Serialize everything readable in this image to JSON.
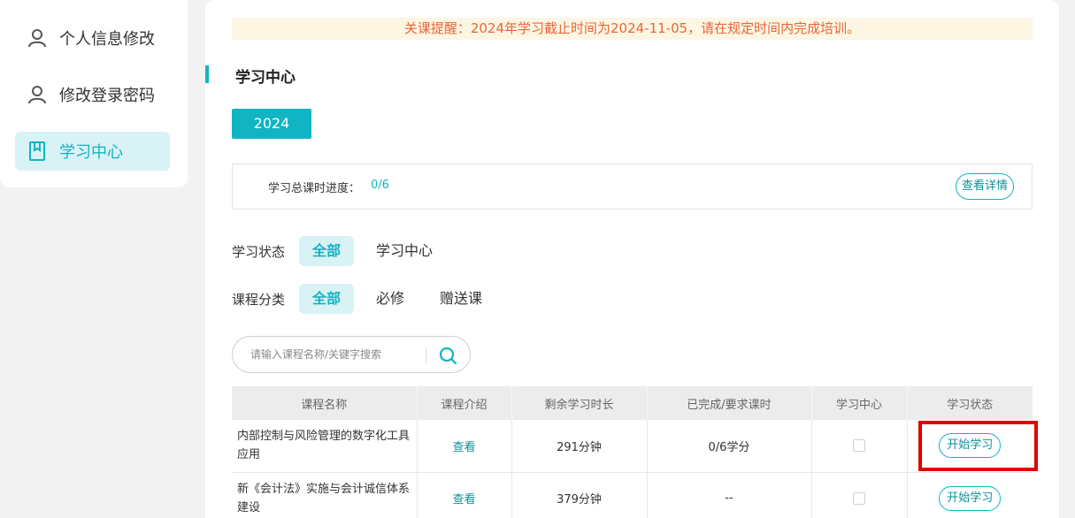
{
  "sidebar": {
    "items": [
      {
        "label": "个人信息修改",
        "icon": "user-icon"
      },
      {
        "label": "修改登录密码",
        "icon": "user-icon"
      },
      {
        "label": "学习中心",
        "icon": "bookmark-icon",
        "active": true
      }
    ]
  },
  "notice": "关课提醒：2024年学习截止时间为2024-11-05，请在规定时间内完成培训。",
  "section_title": "学习中心",
  "year_tab": "2024",
  "progress": {
    "label": "学习总课时进度：",
    "value": "0/6",
    "detail_button": "查看详情"
  },
  "filters": {
    "status": {
      "label": "学习状态",
      "options": [
        "全部",
        "学习中心"
      ],
      "selected": "全部"
    },
    "category": {
      "label": "课程分类",
      "options": [
        "全部",
        "必修",
        "赠送课"
      ],
      "selected": "全部"
    }
  },
  "search": {
    "placeholder": "请输入课程名称/关键字搜索",
    "value": ""
  },
  "table": {
    "headers": [
      "课程名称",
      "课程介绍",
      "剩余学习时长",
      "已完成/要求课时",
      "学习中心",
      "学习状态"
    ],
    "rows": [
      {
        "name": "内部控制与风险管理的数字化工具应用",
        "intro": "查看",
        "remaining": "291分钟",
        "completed": "0/6学分",
        "checked": false,
        "action": "开始学习"
      },
      {
        "name": "新《会计法》实施与会计诚信体系建设",
        "intro": "查看",
        "remaining": "379分钟",
        "completed": "--",
        "checked": false,
        "action": "开始学习"
      }
    ]
  },
  "colors": {
    "accent": "#11b4c2",
    "notice_text": "#e8663a",
    "notice_bg": "#fdf6e3",
    "highlight": "#e00000"
  }
}
